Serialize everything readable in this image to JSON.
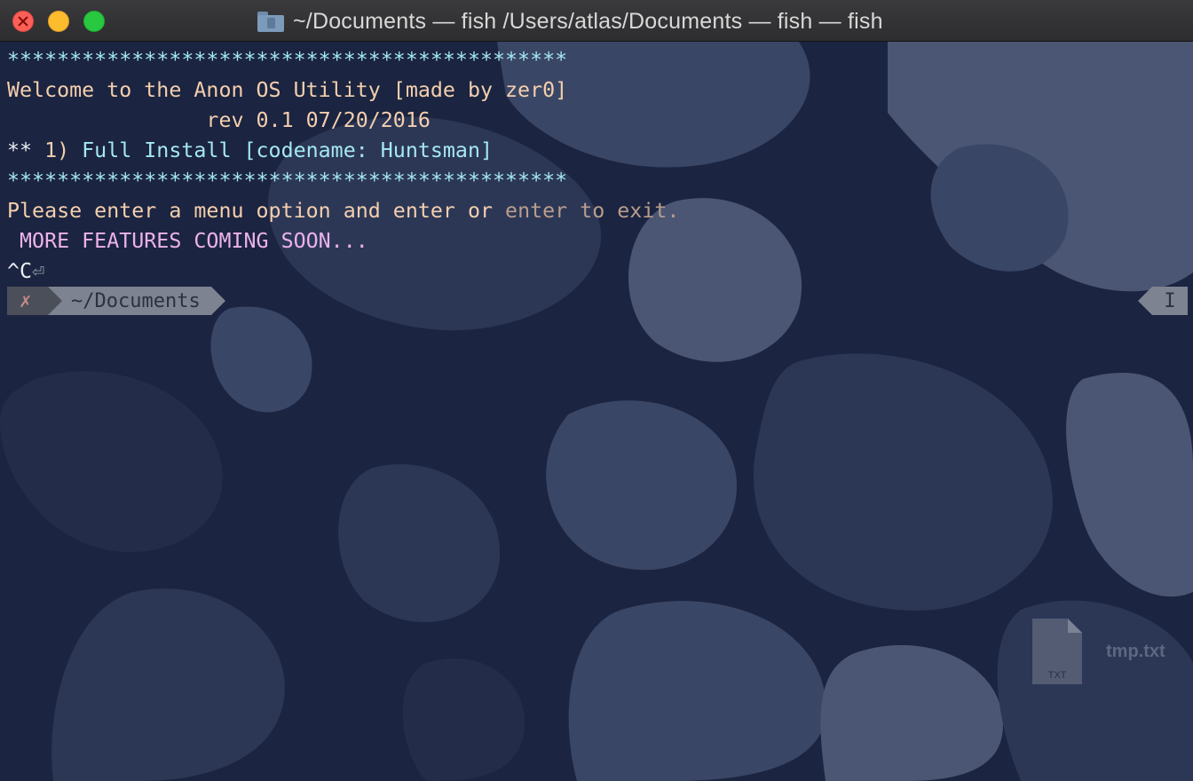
{
  "window": {
    "title": "~/Documents — fish  /Users/atlas/Documents — fish — fish",
    "folder_icon": "folder-document-icon",
    "controls": [
      "close",
      "minimize",
      "zoom"
    ]
  },
  "terminal": {
    "lines": [
      {
        "segments": [
          {
            "text": "*********************************************",
            "color": "#a5e8f0"
          }
        ]
      },
      {
        "segments": [
          {
            "text": "Welcome to the Anon OS Utility [made by zer0]",
            "color": "#f3cfae"
          }
        ]
      },
      {
        "segments": [
          {
            "text": "                rev 0.1 07/20/2016",
            "color": "#f3cfae"
          }
        ]
      },
      {
        "segments": [
          {
            "text": "** ",
            "color": "#e9ecf1"
          },
          {
            "text": "1) ",
            "color": "#f3cfae"
          },
          {
            "text": "Full Install [codename: Huntsman]",
            "color": "#a5e8f0"
          }
        ]
      },
      {
        "segments": [
          {
            "text": "*********************************************",
            "color": "#a5e8f0"
          }
        ]
      },
      {
        "segments": [
          {
            "text": "Please enter a menu option and enter or ",
            "color": "#f3cfae"
          },
          {
            "text": "enter to exit.",
            "color": "#b99d8d"
          }
        ]
      },
      {
        "segments": [
          {
            "text": " MORE FEATURES COMING SOON...",
            "color": "#ecb2ea"
          }
        ]
      },
      {
        "segments": [
          {
            "text": "^C",
            "color": "#e9ecf1"
          },
          {
            "text": "⏎",
            "color": "#9aa1ad"
          }
        ]
      }
    ],
    "prompt": {
      "status_symbol": "✗",
      "path": "~/Documents",
      "right_indicator": "I"
    }
  },
  "desktop_file": {
    "name": "tmp.txt",
    "type_label": "TXT",
    "icon": "text-file-icon"
  }
}
